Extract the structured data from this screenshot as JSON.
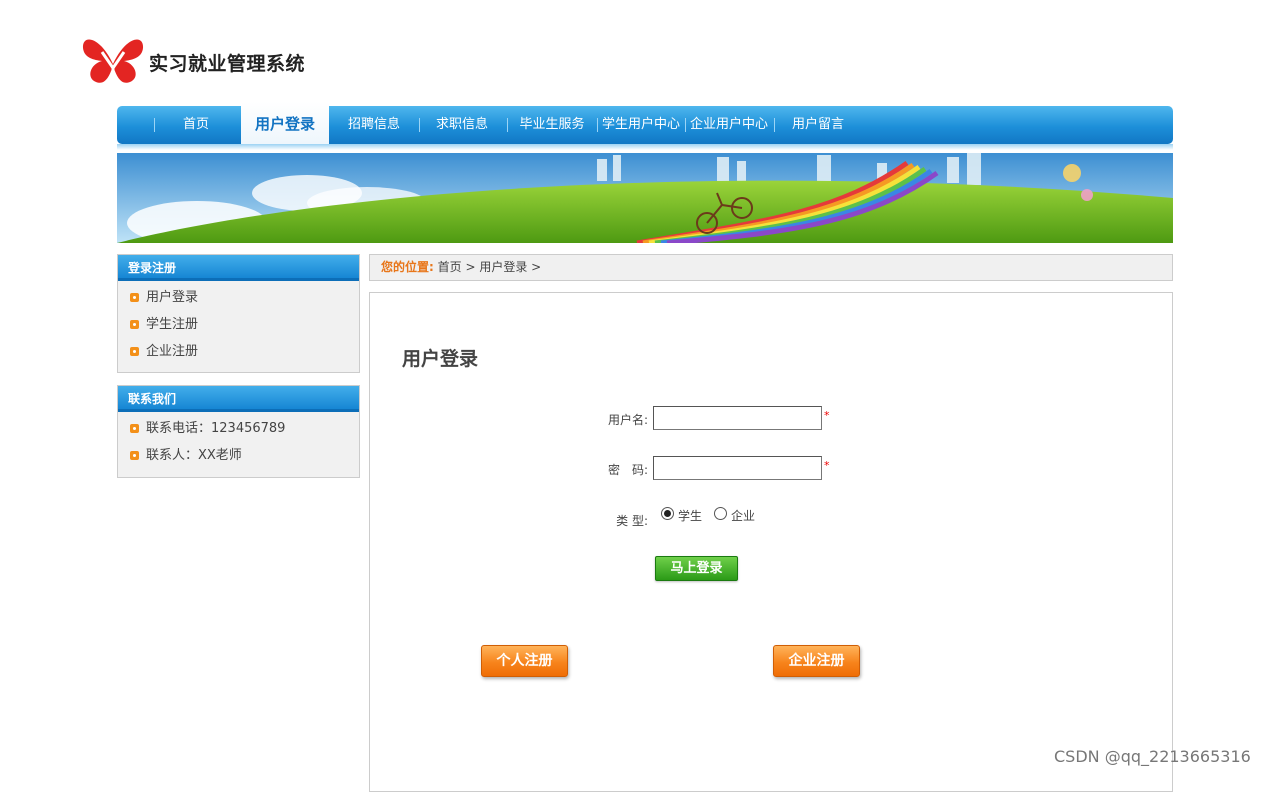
{
  "header": {
    "title": "实习就业管理系统",
    "logo_icon": "butterfly-logo-icon"
  },
  "nav": {
    "items": [
      {
        "label": "首页"
      },
      {
        "label": "用户登录",
        "active": true
      },
      {
        "label": "招聘信息"
      },
      {
        "label": "求职信息"
      },
      {
        "label": "毕业生服务"
      },
      {
        "label": "学生用户中心"
      },
      {
        "label": "企业用户中心"
      },
      {
        "label": "用户留言"
      }
    ]
  },
  "sidebar": {
    "login_box": {
      "title": "登录注册",
      "items": [
        {
          "label": "用户登录"
        },
        {
          "label": "学生注册"
        },
        {
          "label": "企业注册"
        }
      ]
    },
    "contact_box": {
      "title": "联系我们",
      "items": [
        {
          "label": "联系电话：123456789"
        },
        {
          "label": "联系人：XX老师"
        }
      ]
    }
  },
  "breadcrumb": {
    "label": "您的位置:",
    "path": "首页 > 用户登录 >"
  },
  "login_form": {
    "title": "用户登录",
    "username_label": "用户名:",
    "username_value": "",
    "password_label": "密　码:",
    "password_value": "",
    "required_mark": "*",
    "type_label": "类 型:",
    "type_options": [
      {
        "label": "学生",
        "checked": true
      },
      {
        "label": "企业",
        "checked": false
      }
    ],
    "submit_label": "马上登录",
    "personal_register_label": "个人注册",
    "company_register_label": "企业注册"
  },
  "watermark": "CSDN @qq_2213665316",
  "colors": {
    "nav_blue": "#1d8fd9",
    "accent_orange": "#f7841c",
    "button_green": "#2b9a17",
    "breadcrumb_label": "#e8761a"
  }
}
